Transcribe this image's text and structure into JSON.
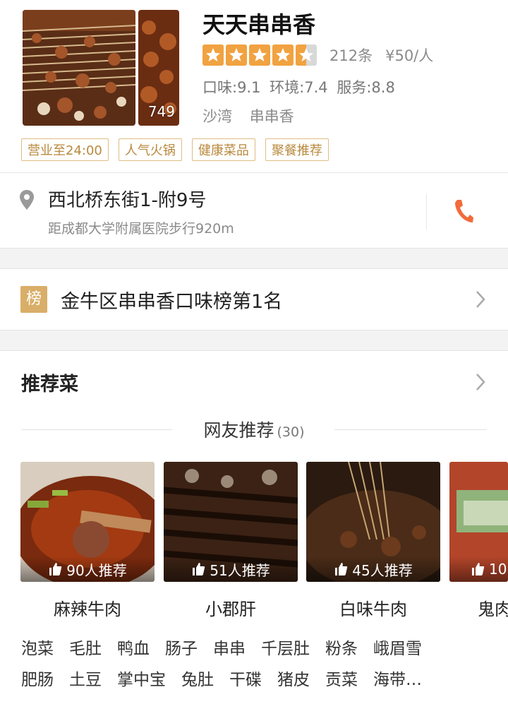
{
  "shop": {
    "name": "天天串串香",
    "photo_count": "749",
    "rating_stars": 4.5,
    "reviews": "212条",
    "price": "¥50/人",
    "scores": {
      "taste": "口味:9.1",
      "environment": "环境:7.4",
      "service": "服务:8.8"
    },
    "area": "沙湾",
    "category": "串串香",
    "tags": [
      "营业至24:00",
      "人气火锅",
      "健康菜品",
      "聚餐推荐"
    ]
  },
  "address": {
    "street": "西北桥东街1-附9号",
    "distance": "距成都大学附属医院步行920m"
  },
  "ranking": {
    "badge": "榜",
    "text": "金牛区串串香口味榜第1名"
  },
  "recommend": {
    "title": "推荐菜",
    "subtitle": "网友推荐",
    "count": "(30)",
    "dishes": [
      {
        "name": "麻辣牛肉",
        "likes": "90人推荐"
      },
      {
        "name": "小郡肝",
        "likes": "51人推荐"
      },
      {
        "name": "白味牛肉",
        "likes": "45人推荐"
      },
      {
        "name": "鬼肉",
        "likes": "10"
      }
    ],
    "more_row1": [
      "泡菜",
      "毛肚",
      "鸭血",
      "肠子",
      "串串",
      "千层肚",
      "粉条",
      "峨眉雪"
    ],
    "more_row2": [
      "肥肠",
      "土豆",
      "掌中宝",
      "兔肚",
      "干碟",
      "猪皮",
      "贡菜",
      "海带…"
    ]
  },
  "colors": {
    "star": "#f1a241",
    "tag": "#b8893d",
    "badge": "#d9ae68",
    "phone": "#f26b3a"
  }
}
